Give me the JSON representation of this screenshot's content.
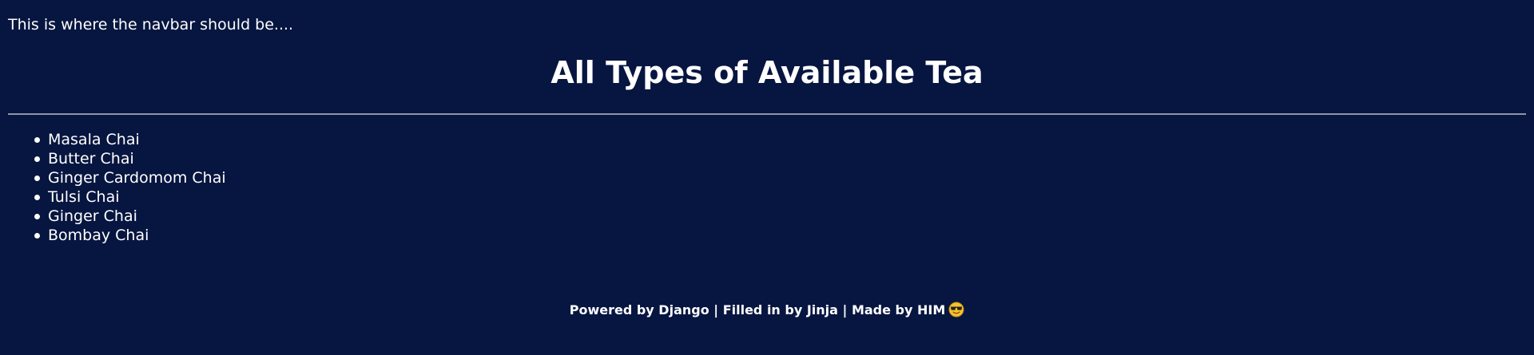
{
  "navbar": {
    "placeholder_text": "This is where the navbar should be...."
  },
  "main": {
    "title": "All Types of Available Tea",
    "tea_list": [
      "Masala Chai",
      "Butter Chai",
      "Ginger Cardomom Chai",
      "Tulsi Chai",
      "Ginger Chai",
      "Bombay Chai"
    ]
  },
  "footer": {
    "text": "Powered by Django | Filled in by Jinja | Made by HIM",
    "emoji_icon": "sunglasses-face-icon"
  },
  "colors": {
    "background": "#071640",
    "text": "#ffffff",
    "divider": "#8e95a8"
  }
}
